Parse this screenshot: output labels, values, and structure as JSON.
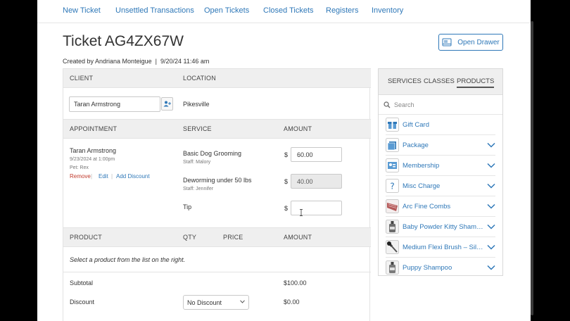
{
  "nav": [
    "New Ticket",
    "Unsettled Transactions",
    "Open Tickets",
    "Closed Tickets",
    "Registers",
    "Inventory"
  ],
  "ticket": {
    "title": "Ticket AG4ZX67W",
    "created_by": "Created by Andriana Monteigue",
    "created_at": "9/20/24 11:46 am",
    "open_drawer_label": "Open Drawer"
  },
  "client_section": {
    "client_header": "CLIENT",
    "location_header": "LOCATION",
    "client_value": "Taran Armstrong",
    "location_value": "Pikesville"
  },
  "appointment_section": {
    "appointment_header": "APPOINTMENT",
    "service_header": "SERVICE",
    "amount_header": "AMOUNT",
    "client_name": "Taran Armstrong",
    "datetime": "9/23/2024 at 1:00pm",
    "pet": "Pet: Rex",
    "remove": "Remove",
    "edit": "Edit",
    "add_discount": "Add Discount",
    "services": [
      {
        "name": "Basic Dog Grooming",
        "staff": "Staff: Malory",
        "amount": "60.00"
      },
      {
        "name": "Deworming under 50 lbs",
        "staff": "Staff: Jennifer",
        "amount": "40.00"
      }
    ],
    "tip_label": "Tip",
    "tip_value": "",
    "currency": "$"
  },
  "product_section": {
    "product_header": "PRODUCT",
    "qty_header": "QTY",
    "price_header": "PRICE",
    "amount_header": "AMOUNT",
    "empty_message": "Select a product from the list on the right."
  },
  "totals": {
    "subtotal_label": "Subtotal",
    "subtotal_value": "$100.00",
    "discount_label": "Discount",
    "discount_select": "No Discount",
    "discount_value": "$0.00"
  },
  "side_panel": {
    "tabs": [
      "SERVICES",
      "CLASSES",
      "PRODUCTS"
    ],
    "active_tab": "PRODUCTS",
    "search_placeholder": "Search",
    "items": [
      {
        "label": "Gift Card",
        "icon": "gift-icon",
        "has_chevron": false
      },
      {
        "label": "Package",
        "icon": "package-icon",
        "has_chevron": true
      },
      {
        "label": "Membership",
        "icon": "membership-icon",
        "has_chevron": true
      },
      {
        "label": "Misc Charge",
        "icon": "question-icon",
        "has_chevron": true
      },
      {
        "label": "Arc Fine Combs",
        "icon": "comb-product-icon",
        "has_chevron": true
      },
      {
        "label": "Baby Powder Kitty Sham…",
        "icon": "shampoo-bottle-icon",
        "has_chevron": true
      },
      {
        "label": "Medium Flexi Brush – Sil…",
        "icon": "brush-product-icon",
        "has_chevron": true
      },
      {
        "label": "Puppy Shampoo",
        "icon": "shampoo-bottle-icon",
        "has_chevron": true
      }
    ]
  },
  "colors": {
    "link": "#2f78b8",
    "header_bg": "#efefef",
    "remove": "#c0392b"
  }
}
